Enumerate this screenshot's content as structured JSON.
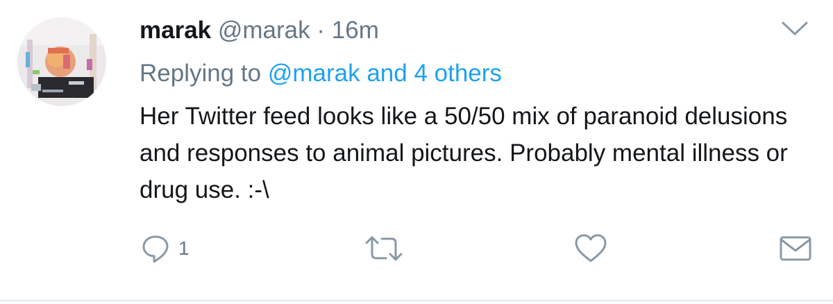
{
  "tweet": {
    "display_name": "marak",
    "handle": "@marak",
    "separator": "·",
    "time": "16m",
    "replying_prefix": "Replying to",
    "replying_targets": "@marak and 4 others",
    "text": "Her Twitter feed looks like a 50/50 mix of paranoid delusions and responses to animal pictures. Probably mental illness or drug use. :-\\",
    "reply_count": "1"
  },
  "icons": {
    "menu": "chevron-down-icon",
    "reply": "reply-bubble-icon",
    "retweet": "retweet-icon",
    "like": "heart-icon",
    "dm": "envelope-icon"
  },
  "colors": {
    "text": "#14171a",
    "muted": "#657786",
    "link": "#1da1f2",
    "divider": "#e1e8ed"
  }
}
